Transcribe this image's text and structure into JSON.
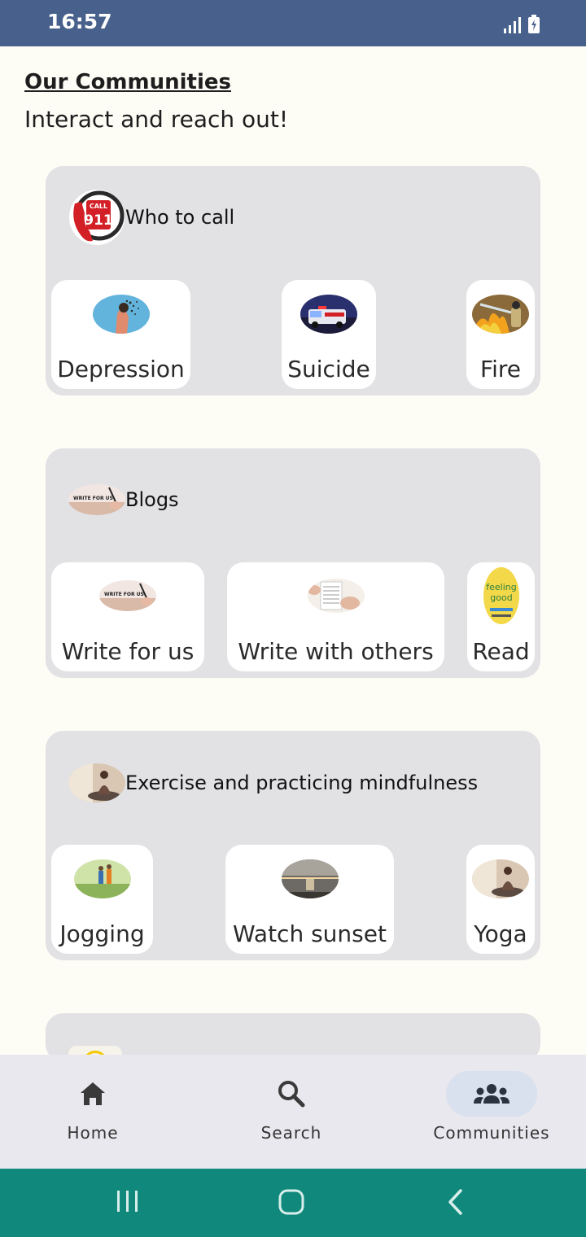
{
  "status_bar": {
    "time": "16:57"
  },
  "header": {
    "title": "Our Communities",
    "subtitle": "Interact and reach out!"
  },
  "sections": [
    {
      "title": "Who to call",
      "icon": "call-911-icon",
      "tiles": [
        {
          "label": "Depression"
        },
        {
          "label": "Suicide"
        },
        {
          "label": "Fire"
        }
      ]
    },
    {
      "title": "Blogs",
      "icon": "write-for-us-image",
      "tiles": [
        {
          "label": "Write for us"
        },
        {
          "label": "Write with others"
        },
        {
          "label": "Read"
        }
      ]
    },
    {
      "title": "Exercise and practicing mindfulness",
      "icon": "meditation-image",
      "tiles": [
        {
          "label": "Jogging"
        },
        {
          "label": "Watch sunset"
        },
        {
          "label": "Yoga"
        }
      ]
    }
  ],
  "bottom_nav": {
    "items": [
      {
        "label": "Home",
        "icon": "home-icon"
      },
      {
        "label": "Search",
        "icon": "search-icon"
      },
      {
        "label": "Communities",
        "icon": "groups-icon",
        "active": true
      }
    ]
  },
  "colors": {
    "status_bar": "#48618c",
    "card_bg": "#e2e2e5",
    "system_nav": "#10897c",
    "active_pill": "#d9e0ee"
  }
}
